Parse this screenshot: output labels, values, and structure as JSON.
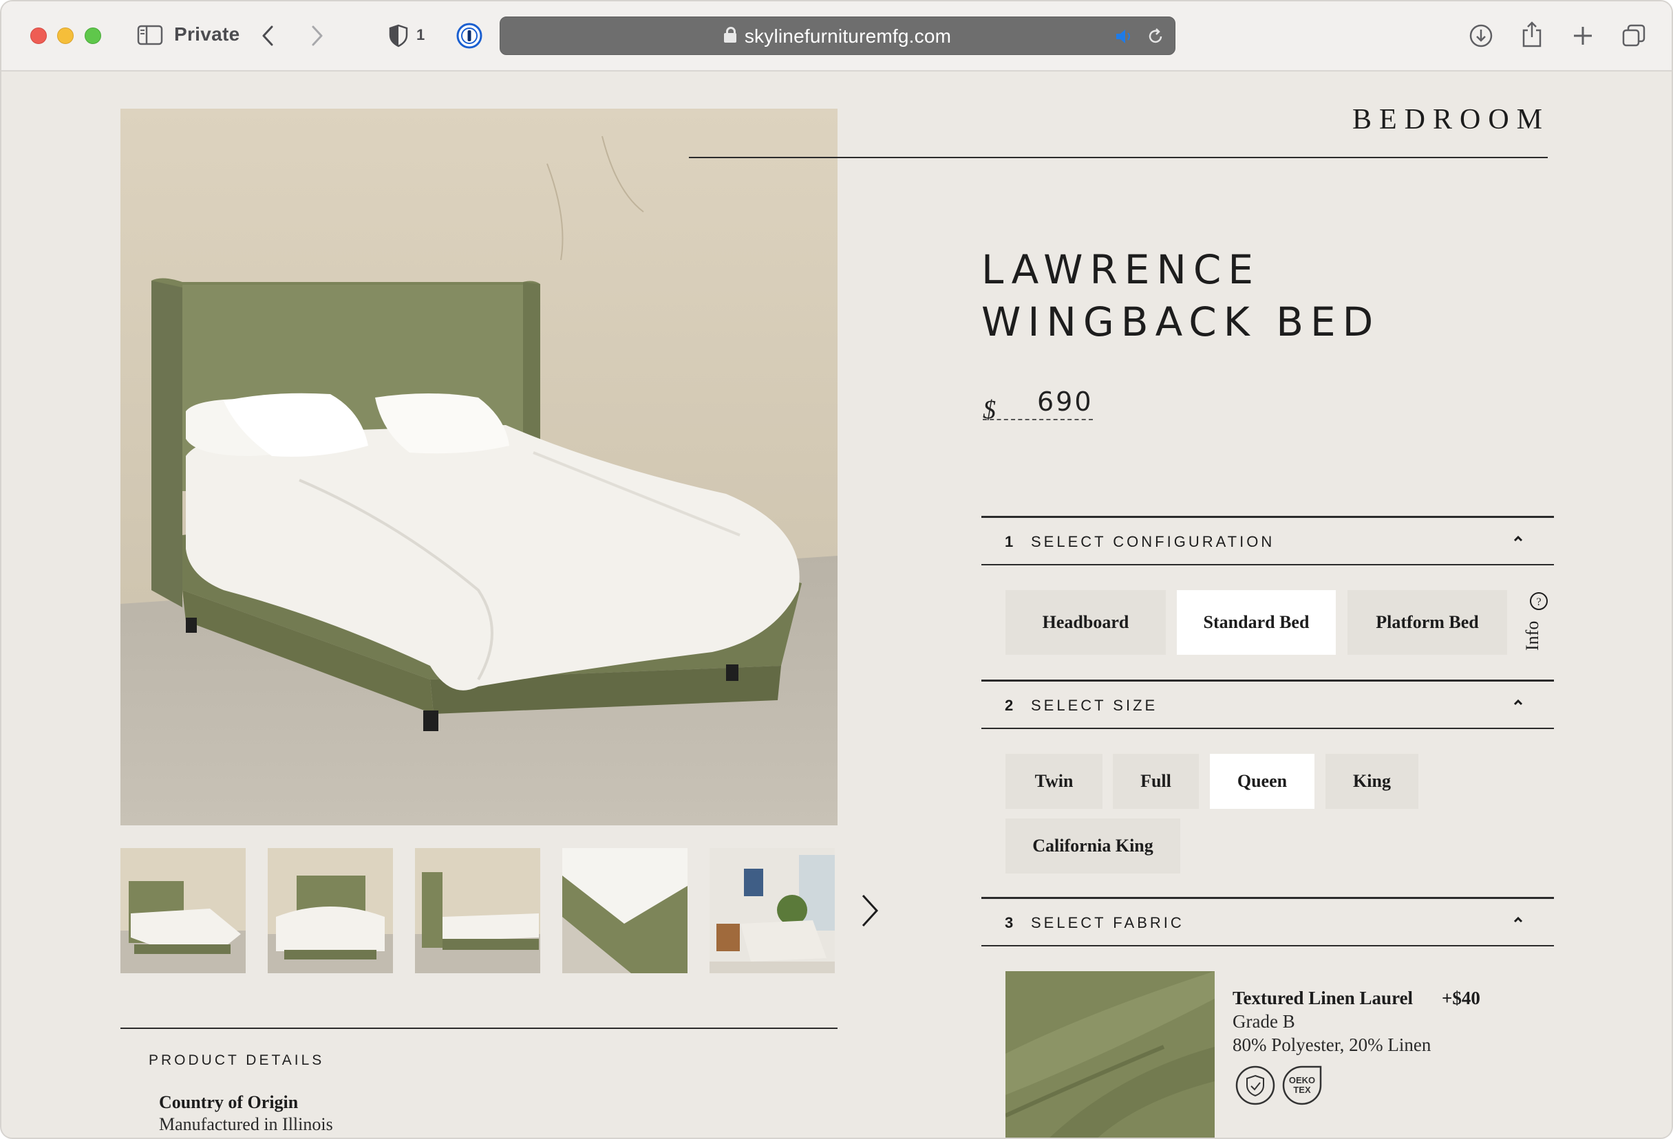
{
  "browser": {
    "mode_label": "Private",
    "shield_count": "1",
    "url": "skylinefurnituremfg.com"
  },
  "page": {
    "category": "BEDROOM",
    "title_line1": "LAWRENCE",
    "title_line2": "WINGBACK BED",
    "currency_symbol": "$",
    "price": "690"
  },
  "configuration": {
    "number": "1",
    "title": "SELECT CONFIGURATION",
    "options": [
      "Headboard",
      "Standard Bed",
      "Platform Bed"
    ],
    "selected": "Standard Bed",
    "info_label": "Info"
  },
  "size": {
    "number": "2",
    "title": "SELECT SIZE",
    "options": [
      "Twin",
      "Full",
      "Queen",
      "King",
      "California King"
    ],
    "selected": "Queen"
  },
  "fabric": {
    "number": "3",
    "title": "SELECT FABRIC",
    "name": "Textured Linen Laurel",
    "price_delta": "+$40",
    "grade": "Grade B",
    "composition": "80% Polyester, 20% Linen",
    "badge_text": "OEKO TEX"
  },
  "details": {
    "heading": "PRODUCT DETAILS",
    "origin_label": "Country of Origin",
    "origin_value": "Manufactured in Illinois"
  },
  "colors": {
    "page_bg": "#ece9e4",
    "fabric_green": "#7f875a",
    "selected_option": "#ffffff",
    "unselected_option": "#e4e1db"
  }
}
